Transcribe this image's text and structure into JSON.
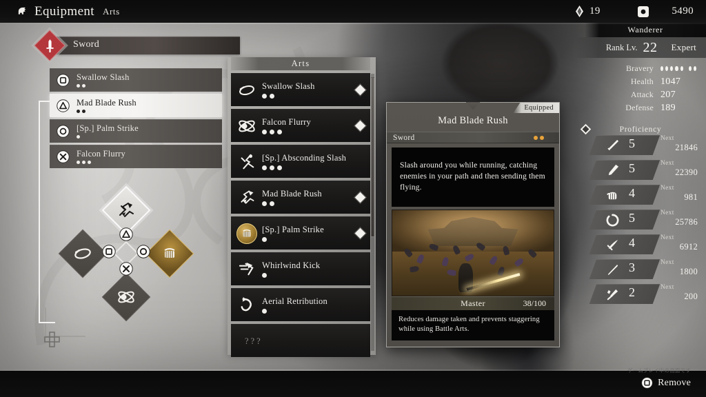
{
  "topbar": {
    "menu_icon": "helm-icon",
    "title": "Equipment",
    "subtitle": "Arts",
    "currency": [
      {
        "icon": "gem-icon",
        "value": "19"
      },
      {
        "icon": "coin-icon",
        "value": "5490"
      }
    ]
  },
  "weapon_header": {
    "icon": "sword-icon",
    "label": "Sword",
    "accent_color": "#b4373c"
  },
  "equipped_arts": {
    "rows": [
      {
        "button": "square",
        "name": "Swallow Slash",
        "dots": 2,
        "selected": false
      },
      {
        "button": "triangle",
        "name": "Mad Blade Rush",
        "dots": 2,
        "selected": true
      },
      {
        "button": "circle",
        "name": "[Sp.] Palm Strike",
        "dots": 1,
        "selected": false
      },
      {
        "button": "cross",
        "name": "Falcon Flurry",
        "dots": 3,
        "selected": false
      }
    ]
  },
  "cluster": {
    "top": {
      "icon": "mad-blade-rush-icon",
      "button": "triangle",
      "selected": true,
      "gold": false
    },
    "left": {
      "icon": "swallow-slash-icon",
      "button": "square",
      "selected": false,
      "gold": false
    },
    "right": {
      "icon": "palm-strike-icon",
      "button": "circle",
      "selected": false,
      "gold": true
    },
    "bottom": {
      "icon": "falcon-flurry-icon",
      "button": "cross",
      "selected": false,
      "gold": false
    }
  },
  "arts_panel": {
    "title": "Arts",
    "items": [
      {
        "icon": "swallow-slash-icon",
        "name": "Swallow Slash",
        "dots": 2,
        "equipped": true,
        "gold": false
      },
      {
        "icon": "falcon-flurry-icon",
        "name": "Falcon Flurry",
        "dots": 3,
        "equipped": true,
        "gold": false
      },
      {
        "icon": "absconding-slash-icon",
        "name": "[Sp.] Absconding Slash",
        "dots": 3,
        "equipped": false,
        "gold": false
      },
      {
        "icon": "mad-blade-rush-icon",
        "name": "Mad Blade Rush",
        "dots": 2,
        "equipped": true,
        "gold": false
      },
      {
        "icon": "palm-strike-icon",
        "name": "[Sp.] Palm Strike",
        "dots": 1,
        "equipped": true,
        "gold": true
      },
      {
        "icon": "whirlwind-kick-icon",
        "name": "Whirlwind Kick",
        "dots": 1,
        "equipped": false,
        "gold": false
      },
      {
        "icon": "aerial-retribution-icon",
        "name": "Aerial Retribution",
        "dots": 1,
        "equipped": false,
        "gold": false
      },
      {
        "icon": "locked-icon",
        "name": "???",
        "dots": 0,
        "equipped": false,
        "gold": false
      }
    ]
  },
  "detail": {
    "equipped_badge": "Equipped",
    "title": "Mad Blade Rush",
    "type": "Sword",
    "type_dots": 2,
    "type_dot_color": "#e8a33a",
    "description": "Slash around you while running, catching enemies in your path and then sending them flying.",
    "skill_label": "Master",
    "skill_value": "38/100",
    "skill_effect": "Reduces damage taken and prevents staggering while using Battle Arts."
  },
  "stats": {
    "class_title": "Wanderer",
    "rank_label": "Rank Lv.",
    "rank_value": "22",
    "rank_name": "Expert",
    "rows": [
      {
        "name": "Bravery",
        "value": "",
        "dots": 7
      },
      {
        "name": "Health",
        "value": "1047"
      },
      {
        "name": "Attack",
        "value": "207"
      },
      {
        "name": "Defense",
        "value": "189"
      }
    ],
    "proficiency_title": "Proficiency",
    "proficiency": [
      {
        "icon": "katana-icon",
        "level": "5",
        "next_label": "Next",
        "next_value": "21846"
      },
      {
        "icon": "greatsword-icon",
        "level": "5",
        "next_label": "Next",
        "next_value": "22390"
      },
      {
        "icon": "fist-icon",
        "level": "4",
        "next_label": "Next",
        "next_value": "981"
      },
      {
        "icon": "ring-icon",
        "level": "5",
        "next_label": "Next",
        "next_value": "25786"
      },
      {
        "icon": "odachi-icon",
        "level": "4",
        "next_label": "Next",
        "next_value": "6912"
      },
      {
        "icon": "spear-icon",
        "level": "3",
        "next_label": "Next",
        "next_value": "1800"
      },
      {
        "icon": "dual-icon",
        "level": "2",
        "next_label": "Next",
        "next_value": "200"
      }
    ]
  },
  "bottombar": {
    "remove_button": {
      "icon": "square",
      "label": "Remove"
    },
    "watermark": "ゲームプレイ中の画面です"
  }
}
